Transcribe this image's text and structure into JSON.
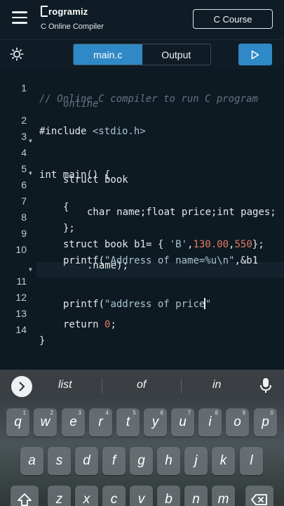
{
  "header": {
    "brand_name": "rogramiz",
    "brand_subtitle": "C Online Compiler",
    "course_button": "C Course"
  },
  "toolbar": {
    "tabs": [
      {
        "label": "main.c",
        "active": true
      },
      {
        "label": "Output",
        "active": false
      }
    ]
  },
  "editor": {
    "lines": [
      {
        "n": "1",
        "fold": false
      },
      {
        "n": "",
        "fold": false
      },
      {
        "n": "2",
        "fold": false
      },
      {
        "n": "3",
        "fold": false
      },
      {
        "n": "4",
        "fold": true
      },
      {
        "n": "5",
        "fold": false
      },
      {
        "n": "6",
        "fold": true
      },
      {
        "n": "7",
        "fold": false
      },
      {
        "n": "8",
        "fold": false
      },
      {
        "n": "9",
        "fold": false
      },
      {
        "n": "10",
        "fold": false
      },
      {
        "n": "",
        "fold": false
      },
      {
        "n": "11",
        "fold": true
      },
      {
        "n": "12",
        "fold": false
      },
      {
        "n": "13",
        "fold": false
      },
      {
        "n": "14",
        "fold": false
      }
    ],
    "code": {
      "l1": "// Online C compiler to run C program",
      "l1b": "online",
      "l2a": "#include ",
      "l2b": "<stdio.h>",
      "l4": "int main() {",
      "l5": "struct book",
      "l6": "{",
      "l7": "char name;float price;int pages;",
      "l8": "};",
      "l9a": "struct book b1= { ",
      "l9b": "'B'",
      "l9c": ",",
      "l9d": "130.00",
      "l9e": ",",
      "l9f": "550",
      "l9g": "};",
      "l10a": "printf(",
      "l10b": "\"Address of name=%u\\n\"",
      "l10c": ",&b1",
      "l10d": ".name);",
      "l11a": "printf(",
      "l11b": "\"address of price",
      "l11c": "\"",
      "l13a": "return ",
      "l13b": "0",
      "l13c": ";",
      "l14": "}"
    }
  },
  "keyboard": {
    "suggestions": [
      "list",
      "of",
      "in"
    ],
    "row1": [
      {
        "k": "q",
        "h": "1"
      },
      {
        "k": "w",
        "h": "2"
      },
      {
        "k": "e",
        "h": "3"
      },
      {
        "k": "r",
        "h": "4"
      },
      {
        "k": "t",
        "h": "5"
      },
      {
        "k": "y",
        "h": "6"
      },
      {
        "k": "u",
        "h": "7"
      },
      {
        "k": "i",
        "h": "8"
      },
      {
        "k": "o",
        "h": "9"
      },
      {
        "k": "p",
        "h": "0"
      }
    ],
    "row2": [
      {
        "k": "a"
      },
      {
        "k": "s"
      },
      {
        "k": "d"
      },
      {
        "k": "f"
      },
      {
        "k": "g"
      },
      {
        "k": "h"
      },
      {
        "k": "j"
      },
      {
        "k": "k"
      },
      {
        "k": "l"
      }
    ],
    "row3": [
      {
        "k": "z"
      },
      {
        "k": "x"
      },
      {
        "k": "c"
      },
      {
        "k": "v"
      },
      {
        "k": "b"
      },
      {
        "k": "n"
      },
      {
        "k": "m"
      }
    ]
  },
  "colors": {
    "accent": "#2f89c6",
    "background": "#0d1a23",
    "number": "#e07a5f",
    "comment": "#5f7480"
  }
}
